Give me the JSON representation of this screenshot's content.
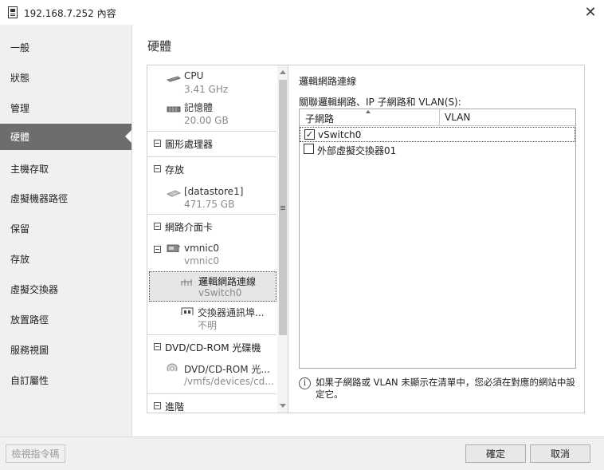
{
  "window": {
    "title": "192.168.7.252 內容"
  },
  "sidebar": {
    "items": [
      {
        "label": "一般"
      },
      {
        "label": "狀態"
      },
      {
        "label": "管理"
      },
      {
        "label": "硬體"
      },
      {
        "label": "主機存取"
      },
      {
        "label": "虛擬機器路徑"
      },
      {
        "label": "保留"
      },
      {
        "label": "存放"
      },
      {
        "label": "虛擬交換器"
      },
      {
        "label": "放置路徑"
      },
      {
        "label": "服務視圖"
      },
      {
        "label": "自訂屬性"
      }
    ],
    "active_index": 3
  },
  "main": {
    "section_title": "硬體",
    "tree": {
      "cpu": {
        "name": "CPU",
        "value": "3.41 GHz"
      },
      "memory": {
        "name": "記憶體",
        "value": "20.00 GB"
      },
      "graphics_group": "圖形處理器",
      "storage_group": "存放",
      "datastore": {
        "name": "[datastore1]",
        "value": "471.75 GB"
      },
      "nic_group": "網路介面卡",
      "vmnic": {
        "name": "vmnic0",
        "value": "vmnic0"
      },
      "logical_network": {
        "name": "邏輯網路連線",
        "value": "vSwitch0"
      },
      "switch_port": {
        "name": "交換器通訊埠...",
        "value": "不明"
      },
      "dvd_group": "DVD/CD-ROM 光碟機",
      "dvd": {
        "name": "DVD/CD-ROM 光...",
        "value": "/vmfs/devices/cd..."
      },
      "advanced_group": "進階"
    },
    "detail": {
      "title": "邏輯網路連線",
      "description": "關聯邏輯網路、IP 子網路和 VLAN(S):",
      "columns": [
        "子網路",
        "VLAN"
      ],
      "rows": [
        {
          "label": "vSwitch0",
          "checked": true
        },
        {
          "label": "外部虛擬交換器01",
          "checked": false
        }
      ],
      "info": "如果子網路或 VLAN 未顯示在清單中，您必須在對應的網站中設定它。"
    }
  },
  "footer": {
    "view_script": "檢視指令碼",
    "ok": "確定",
    "cancel": "取消"
  }
}
